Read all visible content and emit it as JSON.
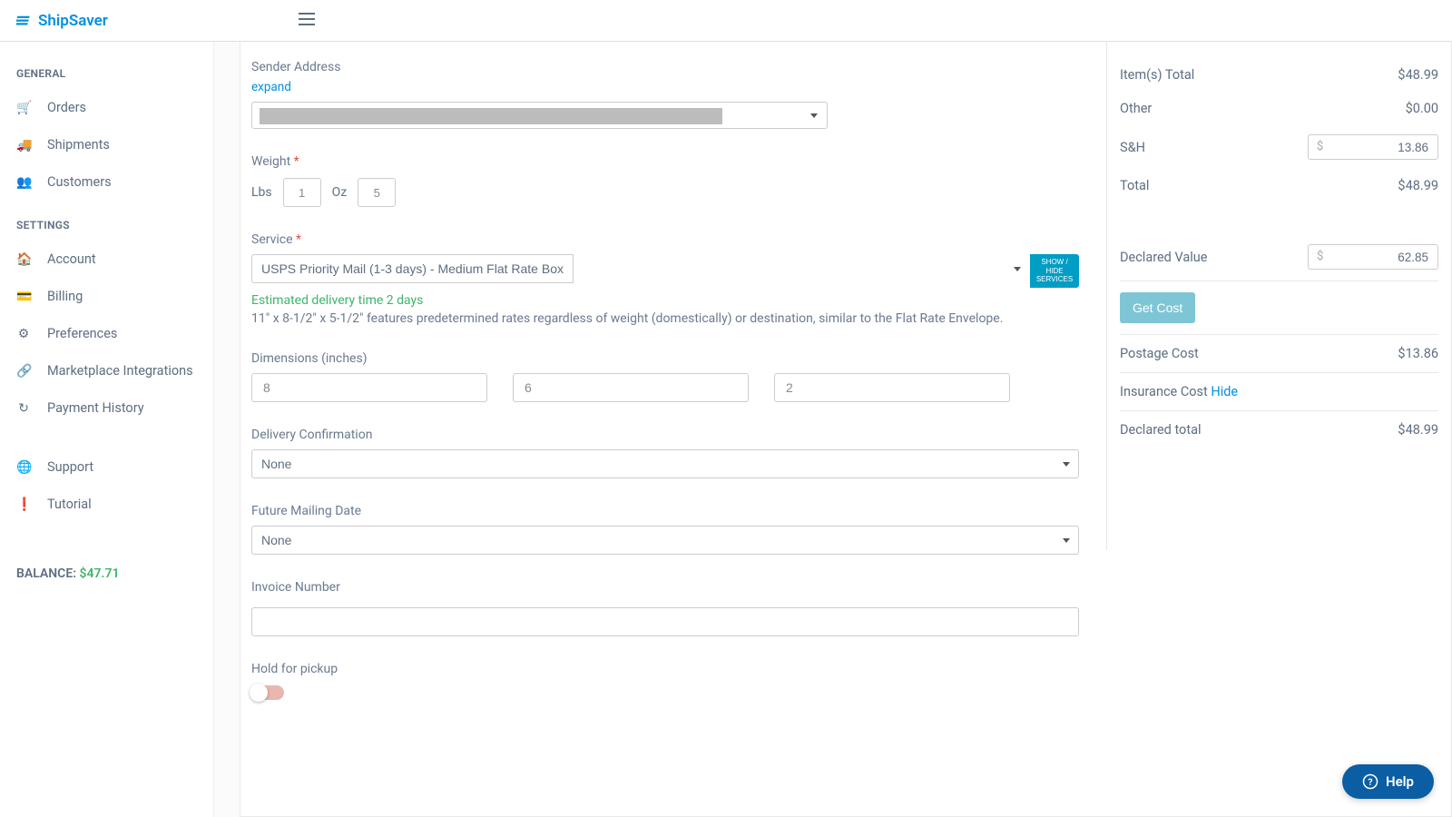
{
  "brand": "ShipSaver",
  "sidebar": {
    "section_general": "GENERAL",
    "section_settings": "SETTINGS",
    "items_general": [
      {
        "label": "Orders"
      },
      {
        "label": "Shipments"
      },
      {
        "label": "Customers"
      }
    ],
    "items_settings": [
      {
        "label": "Account"
      },
      {
        "label": "Billing"
      },
      {
        "label": "Preferences"
      },
      {
        "label": "Marketplace Integrations"
      },
      {
        "label": "Payment History"
      }
    ],
    "support": "Support",
    "tutorial": "Tutorial",
    "balance_label": "BALANCE: ",
    "balance_value": "$47.71"
  },
  "form": {
    "sender_label": "Sender Address",
    "expand": "expand",
    "weight_label": "Weight ",
    "lbs_label": "Lbs",
    "oz_label": "Oz",
    "lbs_value": "1",
    "oz_value": "5",
    "service_label": "Service ",
    "service_selected": "USPS Priority Mail (1-3 days) - Medium Flat Rate Box",
    "show_hide": "SHOW / HIDE SERVICES",
    "est_delivery": "Estimated delivery time 2 days",
    "service_desc": "11\" x 8-1/2\" x 5-1/2\" features predetermined rates regardless of weight (domestically) or destination, similar to the Flat Rate Envelope.",
    "dimensions_label": "Dimensions (inches)",
    "dim_l": "8",
    "dim_w": "6",
    "dim_h": "2",
    "delivery_conf_label": "Delivery Confirmation",
    "delivery_conf_value": "None",
    "mailing_date_label": "Future Mailing Date",
    "mailing_date_value": "None",
    "invoice_label": "Invoice Number",
    "invoice_value": "",
    "hold_label": "Hold for pickup"
  },
  "summary": {
    "items_total_label": "Item(s) Total",
    "items_total": "$48.99",
    "other_label": "Other",
    "other": "$0.00",
    "sh_label": "S&H",
    "sh_value": "13.86",
    "total_label": "Total",
    "total": "$48.99",
    "declared_label": "Declared Value",
    "declared_value": "62.85",
    "get_cost": "Get Cost",
    "postage_cost_label": "Postage Cost",
    "postage_cost": "$13.86",
    "insurance_label": "Insurance Cost ",
    "hide": "Hide",
    "declared_total_label": "Declared total",
    "declared_total": "$48.99"
  },
  "help": "Help"
}
